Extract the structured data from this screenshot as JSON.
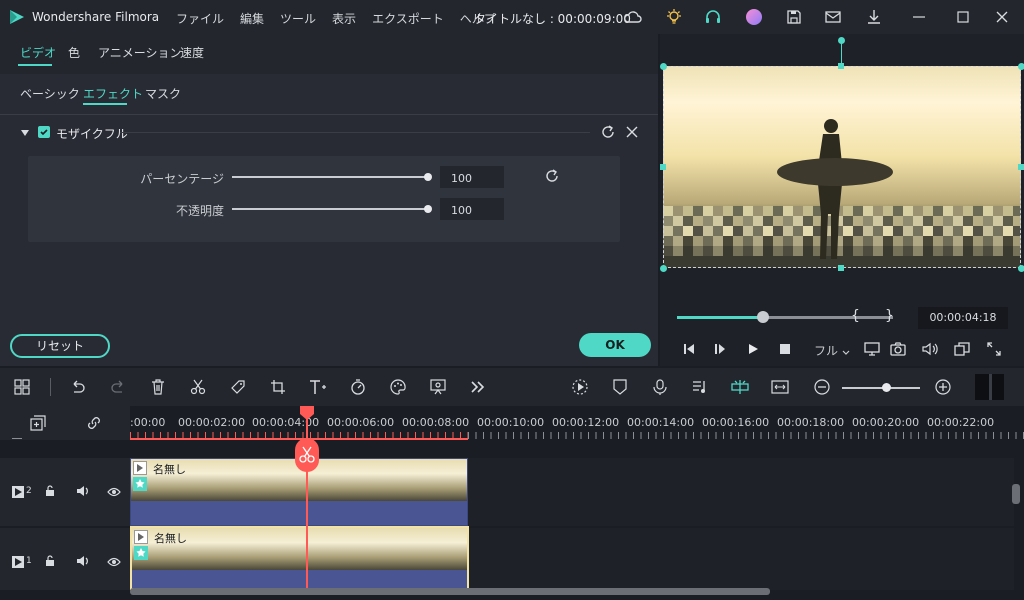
{
  "titlebar": {
    "app_name": "Wondershare Filmora",
    "menu": [
      "ファイル",
      "編集",
      "ツール",
      "表示",
      "エクスポート",
      "ヘルプ"
    ],
    "doc_title": "タイトルなし : 00:00:09:00"
  },
  "panel": {
    "tabs": [
      "ビデオ",
      "色",
      "アニメーション",
      "速度"
    ],
    "subtabs": [
      "ベーシック",
      "エフェクト",
      "マスク"
    ],
    "effect_name": "モザイクフル",
    "params": [
      {
        "label": "パーセンテージ",
        "value": "100",
        "level": 1.0
      },
      {
        "label": "不透明度",
        "value": "100",
        "level": 1.0
      }
    ],
    "reset_label": "リセット",
    "ok_label": "OK"
  },
  "preview": {
    "timecode": "00:00:04:18",
    "quality": "フル",
    "progress": 0.4,
    "bracket_in": "{",
    "bracket_out": "}"
  },
  "timeline": {
    "ruler_labels": [
      ":00:00",
      "00:00:02:00",
      "00:00:04:00",
      "00:00:06:00",
      "00:00:08:00",
      "00:00:10:00",
      "00:00:12:00",
      "00:00:14:00",
      "00:00:16:00",
      "00:00:18:00",
      "00:00:20:00",
      "00:00:22:00"
    ],
    "tracks": [
      {
        "num": "2",
        "clip_label": "名無し"
      },
      {
        "num": "1",
        "clip_label": "名無し"
      }
    ]
  },
  "colors": {
    "accent": "#4fd8c6",
    "playhead": "#ff5a55",
    "clip": "#4a5694",
    "selected_border": "#f2e2a5"
  }
}
